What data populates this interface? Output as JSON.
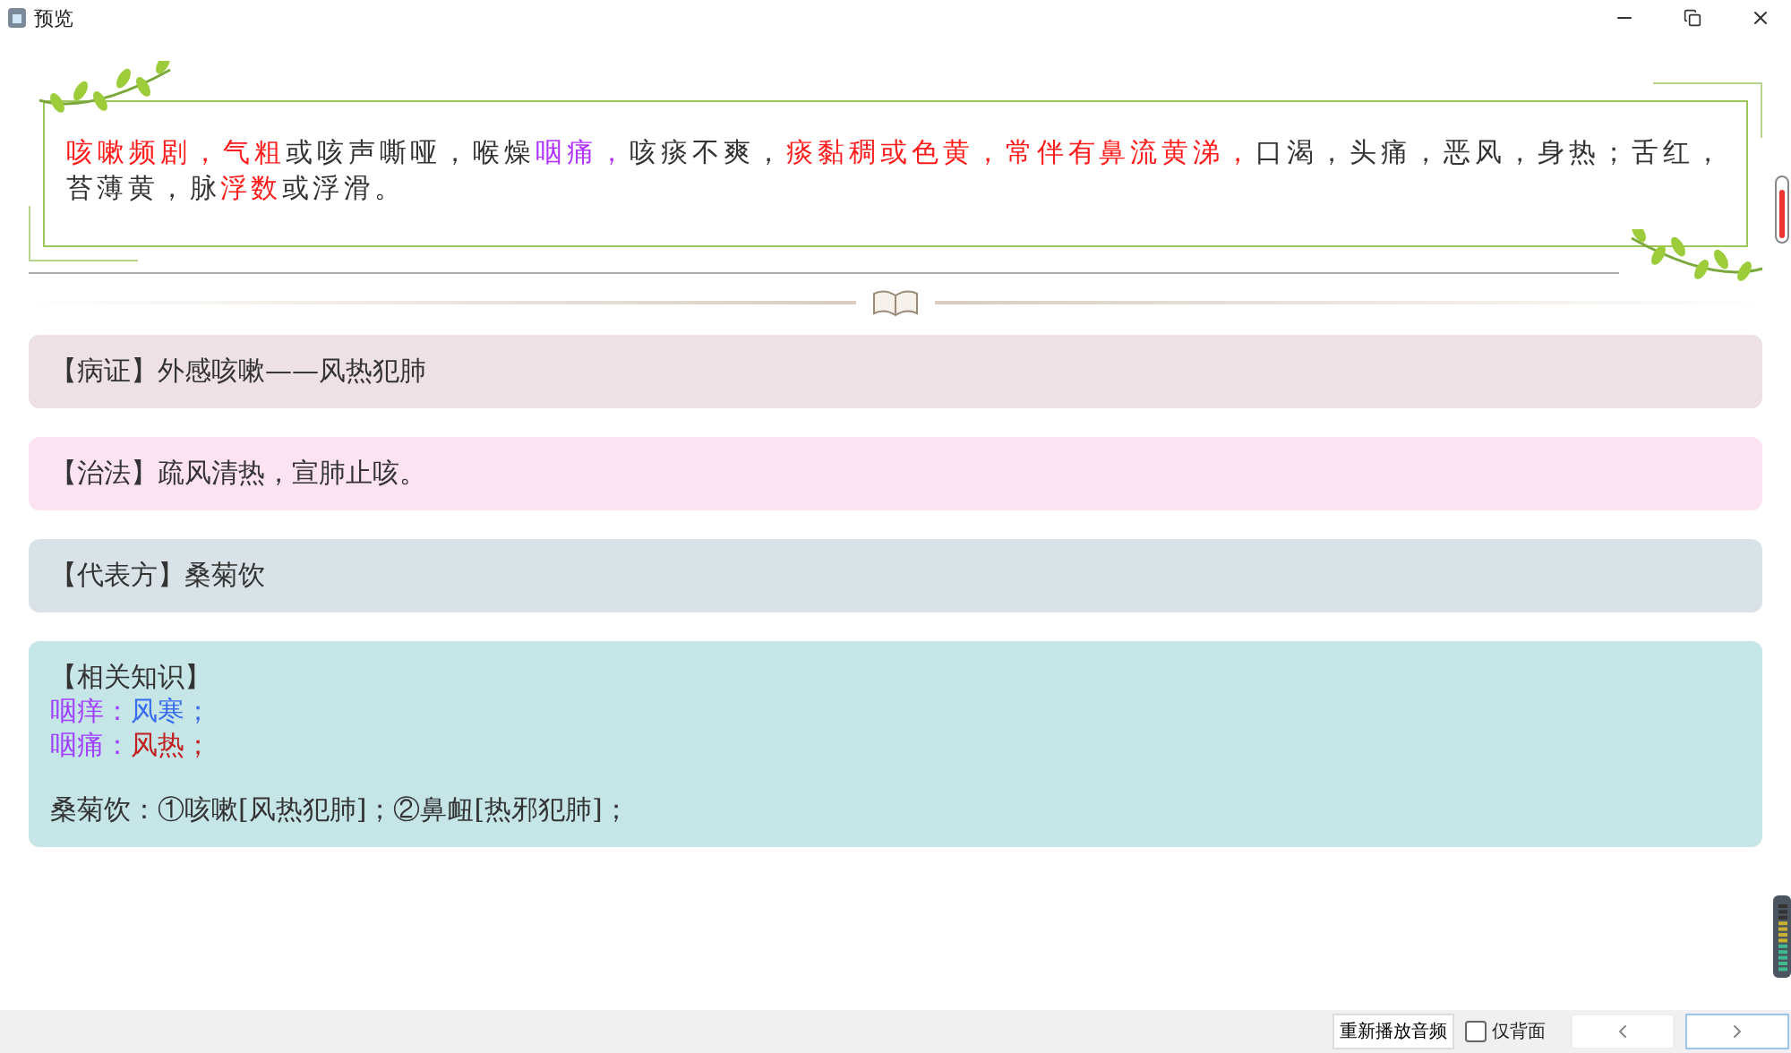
{
  "window": {
    "title": "预览"
  },
  "front": {
    "segments": [
      {
        "text": "咳嗽频剧，气粗",
        "color": "#ff1a1a"
      },
      {
        "text": "或咳声嘶哑，喉燥",
        "color": "#333333"
      },
      {
        "text": "咽痛，",
        "color": "#b030ff"
      },
      {
        "text": "咳痰不爽，",
        "color": "#333333"
      },
      {
        "text": "痰黏稠或色黄，常伴有鼻流黄涕，",
        "color": "#ff1a1a"
      },
      {
        "text": "口渴，头痛，恶风，身热；舌红，苔薄黄，脉",
        "color": "#333333"
      },
      {
        "text": "浮数",
        "color": "#ff1a1a"
      },
      {
        "text": "或浮滑。",
        "color": "#333333"
      }
    ]
  },
  "sections": [
    {
      "kind": "plain",
      "color": "#ede1e5",
      "text": "【病证】外感咳嗽——风热犯肺"
    },
    {
      "kind": "plain",
      "color": "#fde3f1",
      "text": "【治法】疏风清热，宣肺止咳。"
    },
    {
      "kind": "plain",
      "color": "#d9e3e7",
      "text": "【代表方】桑菊饮"
    },
    {
      "kind": "knowledge",
      "color": "#c5e5e7",
      "text": "【相关知识】",
      "lines": [
        {
          "segments": [
            {
              "text": "咽痒：",
              "color": "#a040ff"
            },
            {
              "text": "风寒；",
              "color": "#3a6cf0"
            }
          ]
        },
        {
          "segments": [
            {
              "text": "咽痛：",
              "color": "#a040ff"
            },
            {
              "text": "风热；",
              "color": "#c02020"
            }
          ]
        },
        {
          "segments": [
            {
              "text": "桑菊饮：①咳嗽[风热犯肺]；②鼻衄[热邪犯肺]；",
              "color": "#333333"
            }
          ]
        }
      ]
    }
  ],
  "footer": {
    "replay_button": "重新播放音频",
    "back_only": {
      "label": "仅背面",
      "checked": false
    }
  }
}
